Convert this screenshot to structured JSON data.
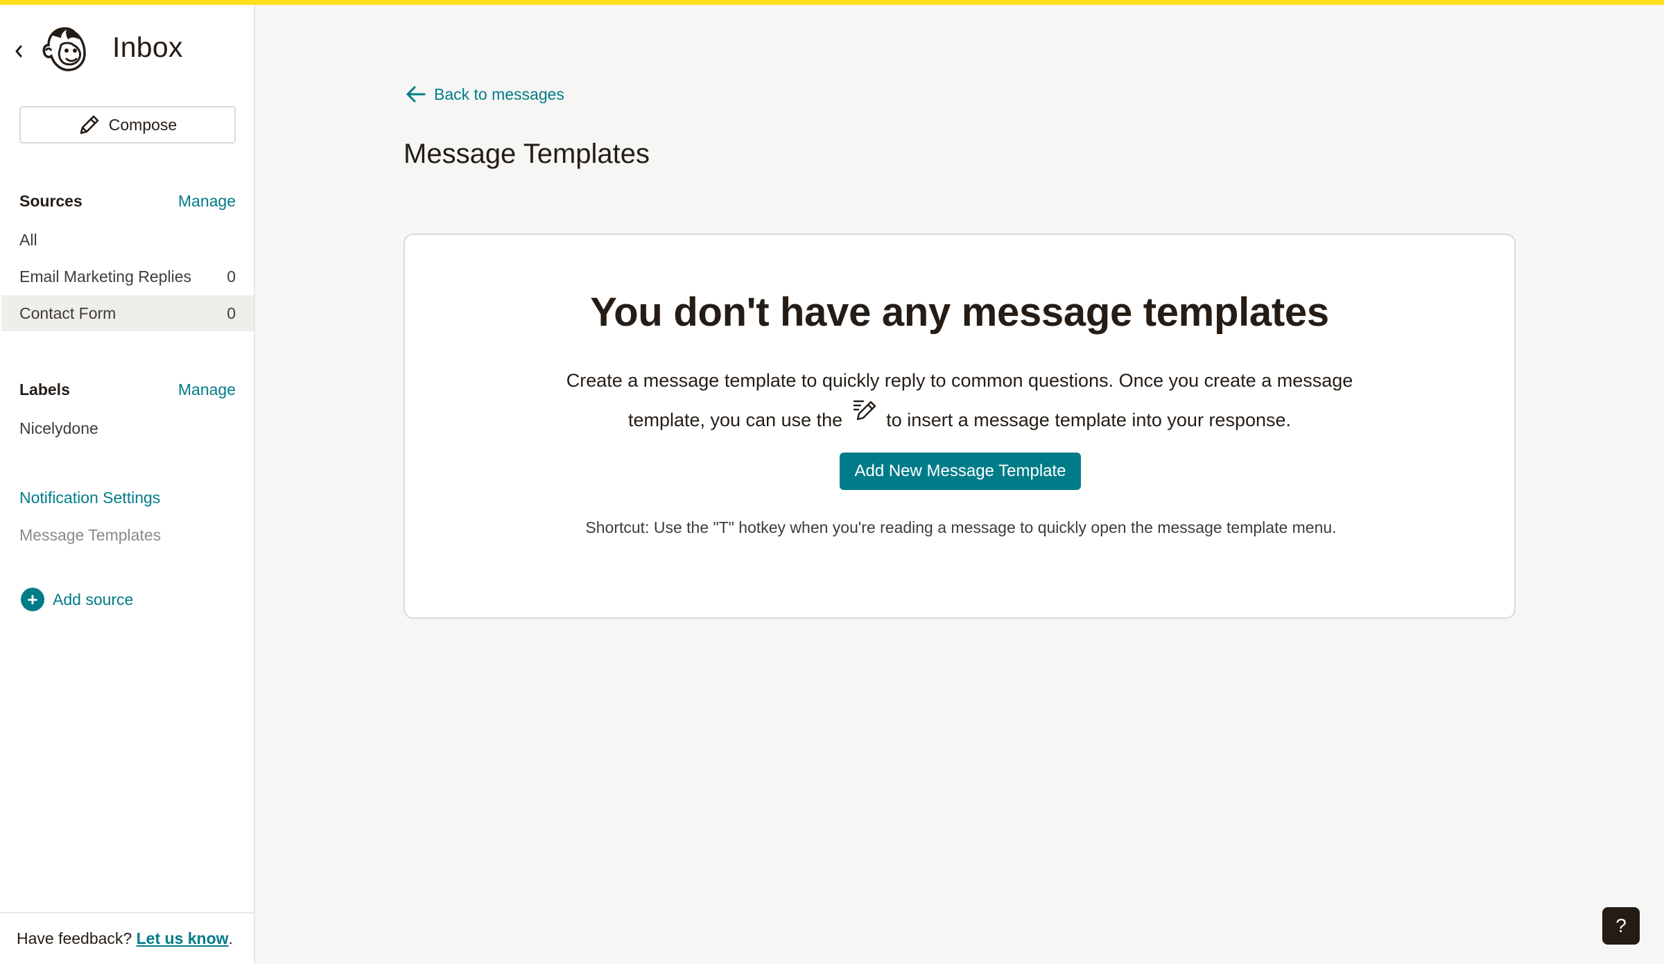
{
  "sidebar": {
    "title": "Inbox",
    "compose_label": "Compose",
    "sources": {
      "title": "Sources",
      "manage_label": "Manage",
      "items": [
        {
          "label": "All",
          "count": ""
        },
        {
          "label": "Email Marketing Replies",
          "count": "0"
        },
        {
          "label": "Contact Form",
          "count": "0"
        }
      ]
    },
    "labels": {
      "title": "Labels",
      "manage_label": "Manage",
      "items": [
        {
          "label": "Nicelydone"
        }
      ]
    },
    "links": {
      "notification_settings": "Notification Settings",
      "message_templates": "Message Templates"
    },
    "add_source_label": "Add source",
    "feedback": {
      "prefix": "Have feedback? ",
      "link": "Let us know",
      "suffix": "."
    }
  },
  "main": {
    "back_label": "Back to messages",
    "page_title": "Message Templates",
    "empty_state": {
      "heading": "You don't have any message templates",
      "desc_line1": "Create a message template to quickly reply to common questions. Once you create a message",
      "desc_line2_before": "template, you can use the",
      "desc_line2_after": "to insert a message template into your response.",
      "button_label": "Add New Message Template",
      "shortcut": "Shortcut: Use the \"T\" hotkey when you're reading a message to quickly open the message template menu."
    },
    "help_label": "?"
  },
  "colors": {
    "accent": "#007c89",
    "top_bar": "#ffe01b",
    "background": "#f6f6f4"
  },
  "icons": {
    "back": "chevron-left-icon",
    "logo": "mailchimp-logo-icon",
    "compose": "pencil-icon",
    "back_arrow": "arrow-left-icon",
    "template": "template-pencil-icon",
    "add": "plus-circle-icon"
  }
}
